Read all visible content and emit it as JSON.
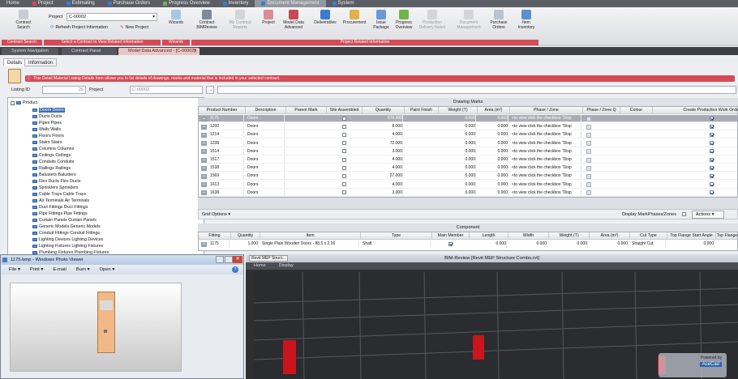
{
  "top_tabs": [
    {
      "label": "Home",
      "color": ""
    },
    {
      "label": "Project",
      "color": "#d64a55"
    },
    {
      "label": "Estimating",
      "color": "#3b7bd1"
    },
    {
      "label": "Purchase Orders",
      "color": "#3b7bd1"
    },
    {
      "label": "Progress Overview",
      "color": "#6fb34a"
    },
    {
      "label": "Inventory",
      "color": "#3b7bd1"
    },
    {
      "label": "Document Management",
      "color": "#3b7bd1"
    },
    {
      "label": "System",
      "color": "#3b7bd1"
    }
  ],
  "ribbon": {
    "contract_search": "Contract Search",
    "project_label": "Project",
    "project_value": "C-00002",
    "refresh": "Refresh Project Information",
    "new_project": "New Project",
    "wizards": "Wizards",
    "contract_bimreview": "Contract BIMReview",
    "my_contract_reports": "My Contract Reports",
    "project": "Project",
    "model_data_advanced": "Model Data Advanced",
    "deliverables": "Deliverables",
    "procurement": "Procurement",
    "issue_package": "Issue Package",
    "progress_overview": "Progress Overview",
    "production_delivery_notes": "Production Delivery Notes",
    "document_management": "Document Management",
    "purchase_orders": "Purchase Orders",
    "item_inventory": "Item Inventory",
    "groups": [
      "Contract Search",
      "Select a Contract to View Related Information",
      "Wizards",
      "Project Related Information"
    ]
  },
  "doc_tabs": [
    "System Navigation",
    "Contract Panel",
    "Model Data Advanced - [C-00002]"
  ],
  "sub_tabs": [
    "Details",
    "Information"
  ],
  "info_text": "This Detail Material Listing Details form allows you to list details of drawings, marks and material that is included in your selected contract.",
  "listing_label": "Listing ID",
  "listing_value": "25",
  "project_label": "Project",
  "project_value": "C-00002",
  "tree": {
    "root": "Product",
    "items": [
      "Doors Doors",
      "Ducts Ducts",
      "Pipes Pipes",
      "Walls Walls",
      "Floors Floors",
      "Stairs Stairs",
      "Columns Columns",
      "Ceilings Ceilings",
      "Conduits Conduits",
      "Railings Railings",
      "Balusters Balusters",
      "Flex Ducts Flex Ducts",
      "Sprinklers Sprinklers",
      "Cable Trays Cable Trays",
      "Air Terminals Air Terminals",
      "Duct Fittings Duct Fittings",
      "Pipe Fittings Pipe Fittings",
      "Curtain Panels Curtain Panels",
      "Generic Models Generic Models",
      "Conduit Fittings Conduit Fittings",
      "Lighting Devices Lighting Devices",
      "Lighting Fixtures Lighting Fixtures",
      "Plumbing Fixtures Plumbing Fixtures"
    ]
  },
  "drawing_marks": {
    "title": "Drawing Marks",
    "columns": [
      "Product Number",
      "Description",
      "Parent Mark",
      "Site Assembled",
      "Quantity",
      "Paint Finish",
      "Weight (T)",
      "Area (m²)",
      "Phase / Zone",
      "Phase / Zone Q",
      "Colour",
      "Create Production Work Order"
    ],
    "rows": [
      {
        "num": "1175",
        "desc": "Doors",
        "qty": "570.000",
        "w": "0.000",
        "a": "0.000",
        "phase": "<to view click the checkbox \"Disp"
      },
      {
        "num": "1200",
        "desc": "Doors",
        "qty": "8.000",
        "w": "0.000",
        "a": "0.000",
        "phase": "<to view click the checkbox \"Disp"
      },
      {
        "num": "1214",
        "desc": "Doors",
        "qty": "4.000",
        "w": "0.000",
        "a": "0.000",
        "phase": "<to view click the checkbox \"Disp"
      },
      {
        "num": "1238",
        "desc": "Doors",
        "qty": "72.000",
        "w": "0.000",
        "a": "0.000",
        "phase": "<to view click the checkbox \"Disp"
      },
      {
        "num": "1514",
        "desc": "Doors",
        "qty": "3.000",
        "w": "0.000",
        "a": "0.000",
        "phase": "<to view click the checkbox \"Disp"
      },
      {
        "num": "1517",
        "desc": "Doors",
        "qty": "4.000",
        "w": "0.000",
        "a": "0.000",
        "phase": "<to view click the checkbox \"Disp"
      },
      {
        "num": "1538",
        "desc": "Doors",
        "qty": "4.000",
        "w": "0.000",
        "a": "0.000",
        "phase": "<to view click the checkbox \"Disp"
      },
      {
        "num": "1569",
        "desc": "Doors",
        "qty": "27.000",
        "w": "0.000",
        "a": "0.000",
        "phase": "<to view click the checkbox \"Disp"
      },
      {
        "num": "1613",
        "desc": "Doors",
        "qty": "4.000",
        "w": "0.000",
        "a": "0.000",
        "phase": "<to view click the checkbox \"Disp"
      },
      {
        "num": "1638",
        "desc": "Doors",
        "qty": "3.000",
        "w": "0.000",
        "a": "0.000",
        "phase": "<to view click the checkbox \"Disp"
      }
    ],
    "grid_options": "Grid Options",
    "display_mark_phases": "Display MarkPhases/Zones",
    "actions": "Actions"
  },
  "component": {
    "title": "Component",
    "columns": [
      "Fitting",
      "Quantity",
      "Item",
      "Type",
      "Main Member",
      "Length",
      "Width",
      "Weight (T)",
      "Area (m²)",
      "Cut Type",
      "Top Flange Start Angle",
      "Top Flange"
    ],
    "row": {
      "fitting": "1175",
      "qty": "1.000",
      "item": "Single Plain Wooden Doors - 88.5 x 2.26",
      "type": "Shaft",
      "length": "0.000",
      "width": "0.000",
      "weight": "0.000",
      "area": "0.000",
      "cut": "Straight Cut",
      "angle": "0.000"
    }
  },
  "photo_viewer": {
    "title": "1175.bmp - Windows Photo Viewer",
    "menu": [
      "File",
      "Print",
      "E-mail",
      "Burn",
      "Open"
    ]
  },
  "revit": {
    "title": "BIM-Review [Revit MEP Structure Combo.rvt]",
    "tab_label": "Revit MEP Struct...",
    "menu": [
      "Home",
      "Display"
    ],
    "badge_line1": "Powered by",
    "badge_line2": "AceCad"
  }
}
